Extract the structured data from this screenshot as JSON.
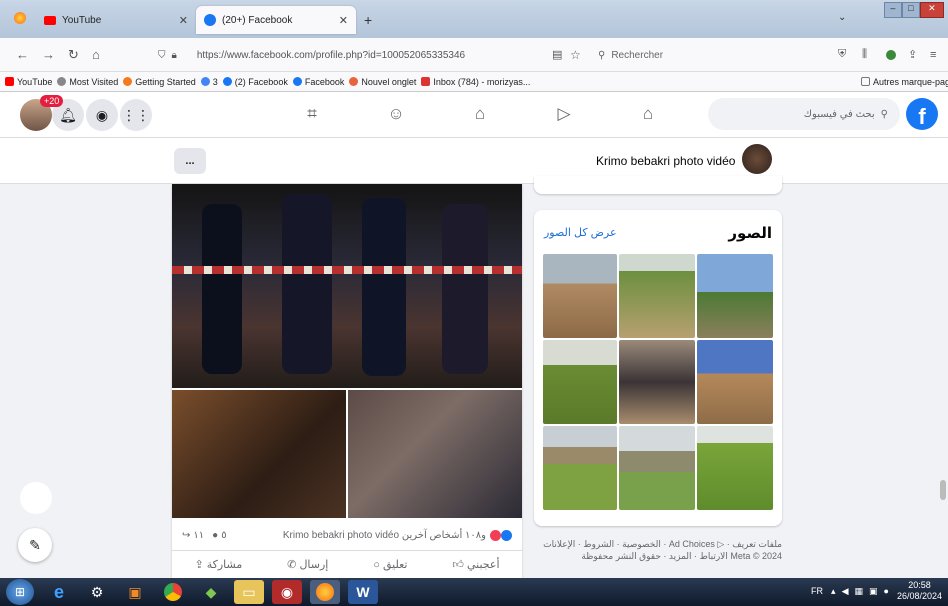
{
  "browser": {
    "tabs": [
      {
        "label": "YouTube"
      },
      {
        "label": "(20+) Facebook"
      }
    ],
    "url": "https://www.facebook.com/profile.php?id=100052065335346",
    "search_placeholder": "Rechercher",
    "bookmarks": [
      "YouTube",
      "Most Visited",
      "Getting Started",
      "3",
      "(2) Facebook",
      "Facebook",
      "Nouvel onglet",
      "Inbox (784) - morizyas..."
    ],
    "other_bookmarks": "Autres marque-pages"
  },
  "fb": {
    "search_placeholder": "بحث في فيسبوك",
    "notif_badge": "+20",
    "profile_name": "Krimo bebakri photo vidéo",
    "more_button": "..."
  },
  "photos": {
    "title": "الصور",
    "see_all": "عرض كل الصور"
  },
  "post": {
    "reactions_text": "Krimo bebakri photo vidéo و١٠٨ أشخاص آخرين",
    "comments_count": "٥",
    "shares_count": "١١",
    "actions": {
      "like": "أعجبني",
      "comment": "تعليق",
      "send": "إرسال",
      "share": "مشاركة"
    }
  },
  "footer": {
    "line1": "الخصوصية · الشروط · الإعلانات · Ad Choices ▷ · ملفات تعريف",
    "line2": "الارتباط · المزيد · حقوق النشر محفوظة Meta © 2024"
  },
  "taskbar": {
    "lang": "FR",
    "time": "20:58",
    "date": "26/08/2024"
  },
  "colors": {
    "fb_blue": "#1877f2",
    "link": "#216fdb",
    "badge": "#e41e3f"
  }
}
